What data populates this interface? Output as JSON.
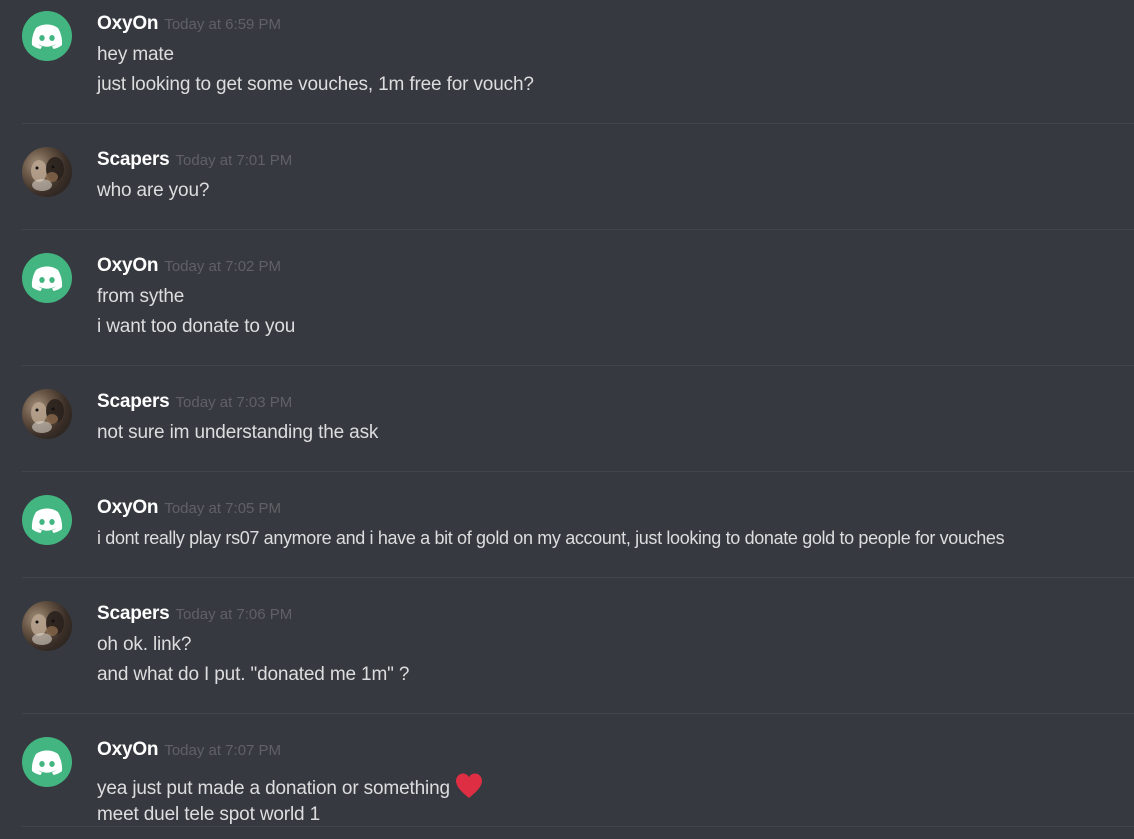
{
  "messages": [
    {
      "author": "OxyOn",
      "time": "Today at 6:59 PM",
      "avatar": "discord-logo-icon",
      "lines": [
        "hey mate",
        "just looking to get some vouches, 1m free for vouch?"
      ]
    },
    {
      "author": "Scapers",
      "time": "Today at 7:01 PM",
      "avatar": "user-photo",
      "lines": [
        "who are you?"
      ]
    },
    {
      "author": "OxyOn",
      "time": "Today at 7:02 PM",
      "avatar": "discord-logo-icon",
      "lines": [
        "from sythe",
        "i want too donate to you"
      ]
    },
    {
      "author": "Scapers",
      "time": "Today at 7:03 PM",
      "avatar": "user-photo",
      "lines": [
        "not sure im understanding the ask"
      ]
    },
    {
      "author": "OxyOn",
      "time": "Today at 7:05 PM",
      "avatar": "discord-logo-icon",
      "lines": [
        "i dont really play rs07 anymore and i have a bit of gold on my account, just looking to donate gold to people for vouches"
      ]
    },
    {
      "author": "Scapers",
      "time": "Today at 7:06 PM",
      "avatar": "user-photo",
      "lines": [
        "oh ok. link?",
        "and what do I put. \"donated me 1m\" ?"
      ]
    },
    {
      "author": "OxyOn",
      "time": "Today at 7:07 PM",
      "avatar": "discord-logo-icon",
      "lines": [
        "yea just put made a donation or something",
        "meet duel tele spot world 1"
      ],
      "emoji": "heart-emoji"
    }
  ],
  "colors": {
    "background": "#36393f",
    "discord_avatar": "#43b581",
    "username": "#ffffff",
    "text": "#dcddde",
    "timestamp": "#5f6166",
    "heart": "#dd2e44"
  }
}
